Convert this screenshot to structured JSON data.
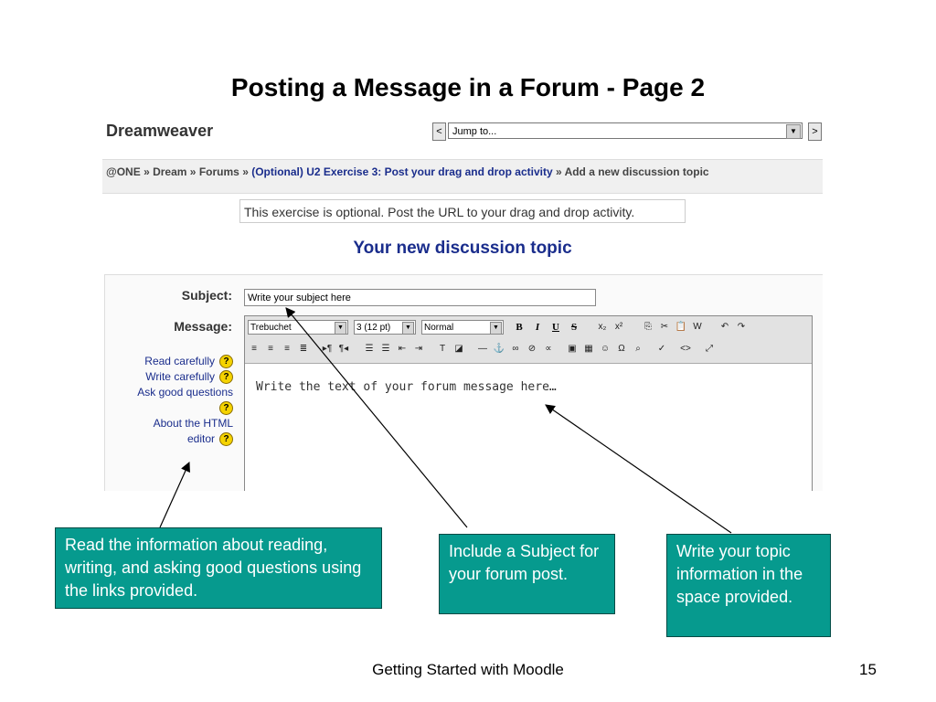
{
  "slide": {
    "title": "Posting a Message in a Forum - Page 2",
    "footer": "Getting Started with Moodle",
    "page_number": "15"
  },
  "screenshot": {
    "course_name": "Dreamweaver",
    "jump_to": {
      "prev_label": "<",
      "placeholder": "Jump to...",
      "next_label": ">"
    },
    "breadcrumb": {
      "items": [
        "@ONE",
        "Dream",
        "Forums"
      ],
      "separator": "»",
      "activity": "(Optional) U2 Exercise 3: Post your drag and drop activity",
      "current": "Add a new discussion topic"
    },
    "intro": "This exercise is optional. Post the URL to your drag and drop activity.",
    "form_heading": "Your new discussion topic",
    "subject_label": "Subject:",
    "subject_value": "Write your subject here",
    "message_label": "Message:",
    "help_links": [
      "Read carefully",
      "Write carefully",
      "Ask good questions",
      "About the HTML editor"
    ],
    "help_icon": "?",
    "editor": {
      "font": "Trebuchet",
      "size": "3 (12 pt)",
      "style": "Normal",
      "body_text": "Write the text of your forum message here…"
    }
  },
  "callouts": {
    "help": "Read the information about reading,  writing, and asking good questions using the links provided.",
    "subject": "Include a Subject for your forum post.",
    "message": "Write your  topic information in the space provided."
  },
  "colors": {
    "callout_bg": "#069a8e",
    "heading_blue": "#1a2d8c"
  }
}
